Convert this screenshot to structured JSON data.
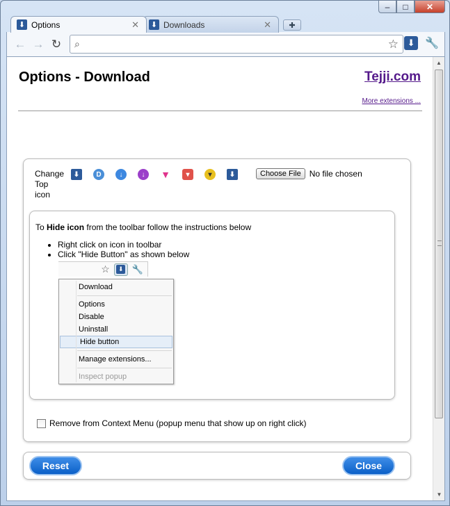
{
  "window": {
    "controls": {
      "minimize": "‒",
      "maximize": "□",
      "close": "✕"
    }
  },
  "tabs": [
    {
      "label": "Options",
      "icon": "download-arrow-icon",
      "active": true
    },
    {
      "label": "Downloads",
      "icon": "download-arrow-icon",
      "active": false
    }
  ],
  "toolbar": {
    "back": "←",
    "forward": "→",
    "reload": "↻",
    "url": "",
    "star": "☆",
    "wrench": "🔧"
  },
  "page": {
    "title": "Options - Download",
    "brand": "Tejji.com",
    "more_link": "More extensions ..."
  },
  "icon_chooser": {
    "label_line1": "Change",
    "label_line2": "Top",
    "label_line3": "icon",
    "icons": [
      {
        "name": "blue-square-download-icon",
        "color": "#2c5a9a"
      },
      {
        "name": "d-circle-icon",
        "color": "#4a8fd8"
      },
      {
        "name": "blue-circle-arrow-icon",
        "color": "#3d88e0"
      },
      {
        "name": "purple-circle-arrow-icon",
        "color": "#9b3fc9"
      },
      {
        "name": "pink-green-arrow-icon",
        "color": "#e0348c"
      },
      {
        "name": "red-box-arrow-icon",
        "color": "#e0524a"
      },
      {
        "name": "yellow-ball-arrow-icon",
        "color": "#e8c020"
      },
      {
        "name": "dark-blue-download-icon",
        "color": "#2c5a9a"
      }
    ],
    "choose_button": "Choose File",
    "no_file": "No file chosen"
  },
  "hide_instructions": {
    "prefix": "To ",
    "bold1": "Hide icon",
    "middle": " from the toolbar follow the instructions below",
    "bullets": [
      "Right click on icon in toolbar",
      "Click \"Hide Button\" as shown below"
    ],
    "menu": {
      "download": "Download",
      "options": "Options",
      "disable": "Disable",
      "uninstall": "Uninstall",
      "hide": "Hide button",
      "manage": "Manage extensions...",
      "inspect": "Inspect popup"
    }
  },
  "context_option": {
    "label": "Remove from Context Menu (popup menu that show up on right click)",
    "checked": false
  },
  "buttons": {
    "reset": "Reset",
    "close": "Close"
  }
}
